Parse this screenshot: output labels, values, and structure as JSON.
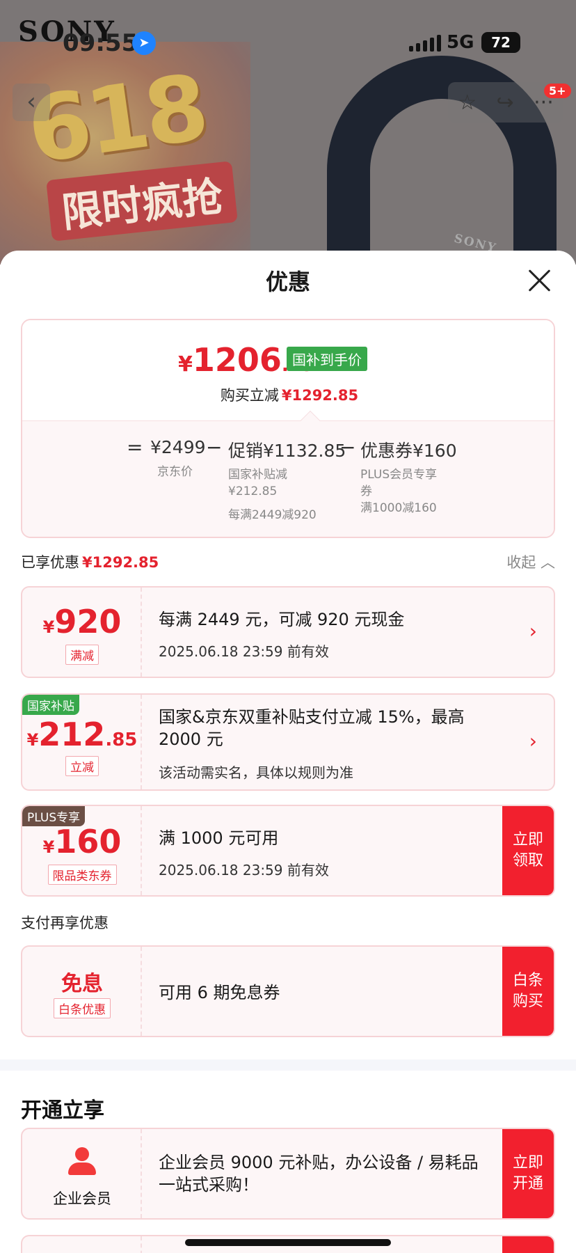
{
  "status_bar": {
    "time": "09:55",
    "network": "5G",
    "battery": "72"
  },
  "background": {
    "brand": "SONY",
    "promo_number": "618",
    "promo_text": "限时疯抢",
    "nav_badge": "5+"
  },
  "sheet": {
    "title": "优惠",
    "price_card": {
      "currency": "¥",
      "final_int": "1206",
      "final_dec": ".15",
      "tag": "国补到手价",
      "reduce_label": "购买立减",
      "reduce_amount": "¥1292.85",
      "formula": [
        {
          "op": "=",
          "value": "¥2499",
          "labels": [
            "京东价"
          ]
        },
        {
          "op": "−",
          "value": "促销¥1132.85",
          "labels": [
            "国家补贴减",
            "¥212.85",
            "每满2449减920"
          ]
        },
        {
          "op": "−",
          "value": "优惠券¥160",
          "labels": [
            "PLUS会员专享",
            "券",
            "满1000减160"
          ]
        }
      ]
    },
    "enjoyed": {
      "label": "已享优惠",
      "amount": "¥1292.85",
      "collapse": "收起"
    },
    "coupons": [
      {
        "currency": "¥",
        "amount": "920",
        "dec": "",
        "tag": "满减",
        "corner": "",
        "title": "每满 2449 元，可减 920 元现金",
        "sub": "2025.06.18 23:59 前有效",
        "action": ""
      },
      {
        "currency": "¥",
        "amount": "212",
        "dec": ".85",
        "tag": "立减",
        "corner": "国家补贴",
        "title": "国家&京东双重补贴支付立减 15%，最高 2000 元",
        "sub": "该活动需实名，具体以规则为准",
        "action": ""
      },
      {
        "currency": "¥",
        "amount": "160",
        "dec": "",
        "tag": "限品类东券",
        "corner": "PLUS专享",
        "title": "满 1000 元可用",
        "sub": "2025.06.18 23:59 前有效",
        "action": "立即领取"
      }
    ],
    "pay_section": {
      "label": "支付再享优惠",
      "card": {
        "main": "免息",
        "tag": "白条优惠",
        "title": "可用 6 期免息券",
        "action": "白条购买"
      }
    },
    "open_section": {
      "title": "开通立享",
      "card": {
        "name": "企业会员",
        "title": "企业会员 9000 元补贴，办公设备 / 易耗品一站式采购！",
        "action": "立即开通"
      }
    }
  },
  "colors": {
    "accent_red": "#e4222e",
    "action_red": "#f2202e",
    "green_tag": "#38a84b",
    "plus_brown": "#6b4f45"
  },
  "icons": [
    "location-arrow-icon",
    "back-chevron-icon",
    "star-icon",
    "share-icon",
    "more-icon",
    "close-icon",
    "chevron-right-icon",
    "chevron-up-icon",
    "enterprise-member-icon"
  ]
}
